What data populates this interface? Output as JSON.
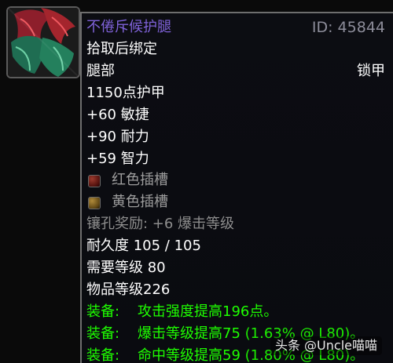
{
  "item": {
    "icon_name": "leg-armor-icon",
    "name": "不倦斥候护腿",
    "id": "ID: 45844",
    "bind": "拾取后绑定",
    "slot": "腿部",
    "armor_type": "锁甲",
    "armor": "1150点护甲",
    "stats": [
      "+60 敏捷",
      "+90 耐力",
      "+59 智力"
    ],
    "sockets": [
      {
        "label": "红色插槽",
        "icon": "red-socket-icon"
      },
      {
        "label": "黄色插槽",
        "icon": "yellow-socket-icon"
      }
    ],
    "socket_bonus": "镶孔奖励: +6 爆击等级",
    "durability": "耐久度 105 / 105",
    "required_level": "需要等级 80",
    "item_level": "物品等级226",
    "equips": [
      {
        "prefix": "装备:",
        "text": "攻击强度提高196点。",
        "paren": ""
      },
      {
        "prefix": "装备:",
        "text": "爆击等级提高75",
        "paren": "(1.63% @ L80)。"
      },
      {
        "prefix": "装备:",
        "text": "命中等级提高59",
        "paren": "(1.80% @ L80)。"
      }
    ]
  },
  "watermark": "头条 @Uncle喵喵",
  "colors": {
    "item_name": "#7f62d9",
    "item_id": "#8d8d9a",
    "text": "#ffffff",
    "socket_text": "#9d9d9d",
    "socket_bonus": "#8d8d8d",
    "equip": "#1eff00",
    "background": "#0a0b10"
  }
}
